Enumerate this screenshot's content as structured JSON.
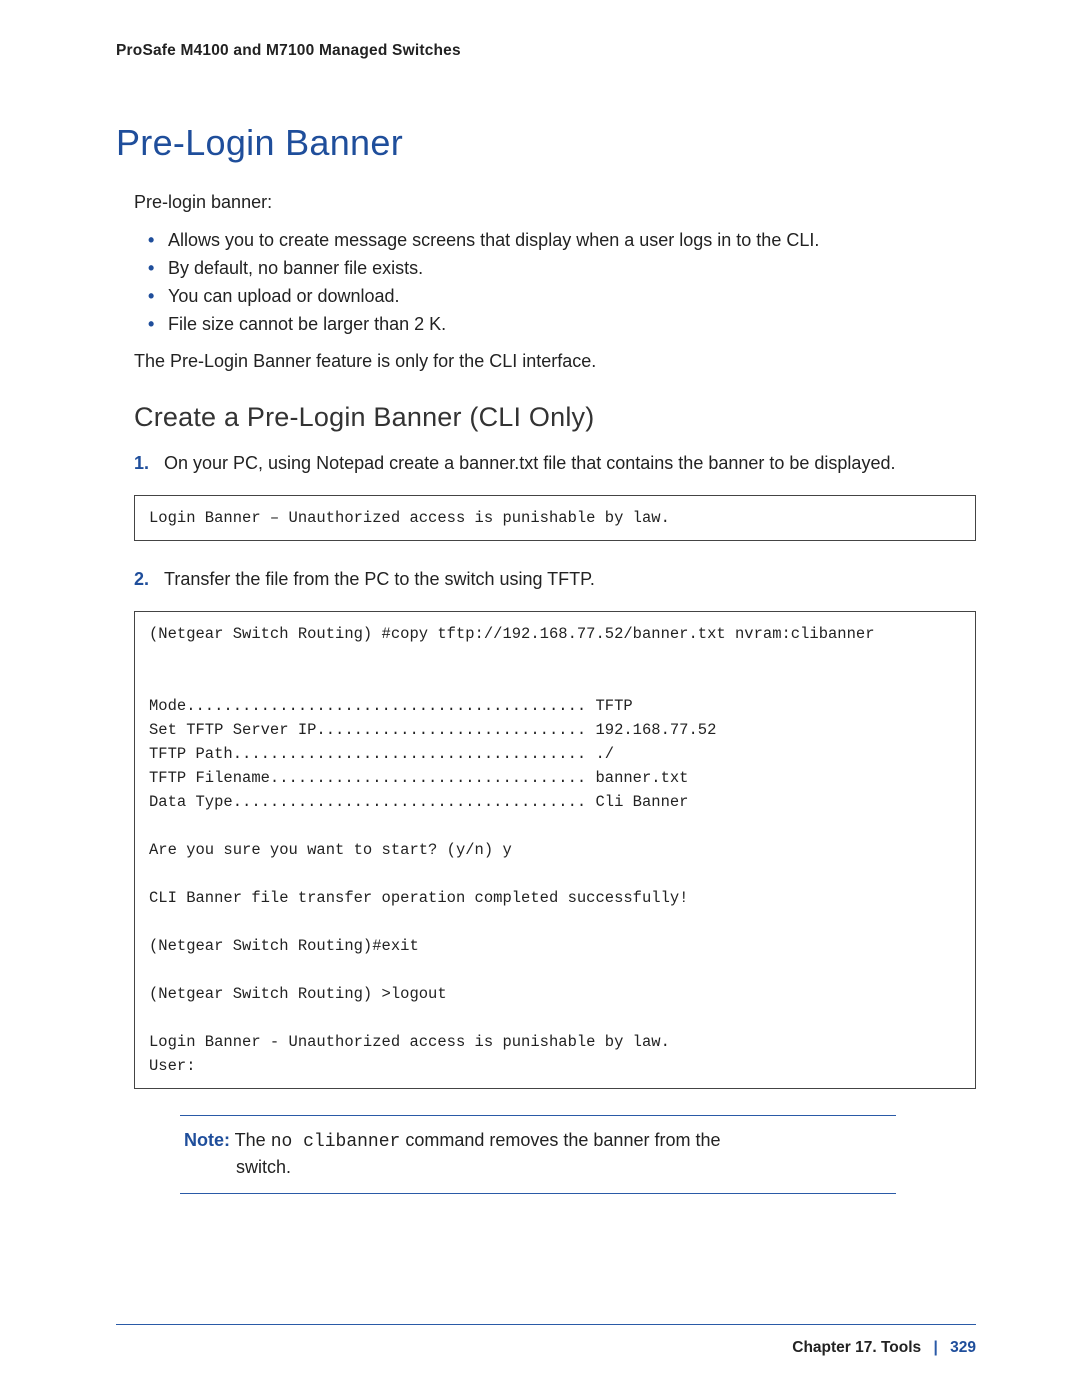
{
  "header": {
    "product_line": "ProSafe M4100 and M7100 Managed Switches"
  },
  "section": {
    "title": "Pre-Login Banner",
    "intro": "Pre-login banner:",
    "bullets": [
      "Allows you to create message screens that display when a user logs in to the CLI.",
      "By default, no banner file exists.",
      "You can upload or download.",
      "File size cannot be larger than 2 K."
    ],
    "after_bullets": "The Pre-Login Banner feature is only for the CLI interface."
  },
  "subsection": {
    "title": "Create a Pre-Login Banner (CLI Only)",
    "steps": [
      "On your PC, using Notepad create a banner.txt file that contains the banner to be displayed.",
      "Transfer the file from the PC to the switch using TFTP."
    ]
  },
  "code1": "Login Banner – Unauthorized access is punishable by law.",
  "code2": "(Netgear Switch Routing) #copy tftp://192.168.77.52/banner.txt nvram:clibanner\n\n\nMode........................................... TFTP\nSet TFTP Server IP............................. 192.168.77.52\nTFTP Path...................................... ./\nTFTP Filename.................................. banner.txt\nData Type...................................... Cli Banner\n\nAre you sure you want to start? (y/n) y\n\nCLI Banner file transfer operation completed successfully!\n\n(Netgear Switch Routing)#exit\n\n(Netgear Switch Routing) >logout\n\nLogin Banner - Unauthorized access is punishable by law.\nUser:",
  "note": {
    "label": "Note:",
    "pre": " The ",
    "cmd": "no clibanner",
    "post": " command removes the banner from the",
    "cont": "switch."
  },
  "footer": {
    "chapter": "Chapter 17.  Tools",
    "page": "329"
  }
}
